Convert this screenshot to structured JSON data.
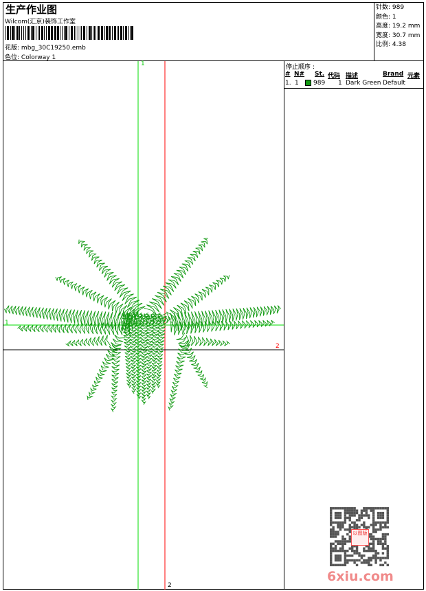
{
  "header": {
    "title": "生产作业图",
    "company": "Wilcom(汇京)装饰工作室",
    "design_label": "花版:",
    "design_value": "mbg_30C19250.emb",
    "colorway_label": "色位:",
    "colorway_value": "Colorway 1"
  },
  "info": {
    "stitches_label": "针数:",
    "stitches": "989",
    "colors_label": "颜色:",
    "colors": "1",
    "height_label": "高度:",
    "height": "19.2 mm",
    "width_label": "宽度:",
    "width": "30.7 mm",
    "scale_label": "比例:",
    "scale": "4.38"
  },
  "stop_sequence": {
    "title": "停止顺序 :",
    "columns": [
      "#",
      "N#",
      "St.",
      "代码",
      "描述",
      "Brand",
      "元素"
    ],
    "rows": [
      {
        "num": "1.",
        "n": "1",
        "color": "#119911",
        "st": "989",
        "code": "1",
        "desc": "Dark Green",
        "brand": "Default"
      }
    ]
  },
  "axes": {
    "green_top": "1",
    "green_left": "1",
    "red_right": "2",
    "red_bottom": "2",
    "green": "#00dd00",
    "red": "#ff0000"
  },
  "design_color": "#119911",
  "watermark": {
    "site": "6xiu.com",
    "stamp": "以图版"
  }
}
